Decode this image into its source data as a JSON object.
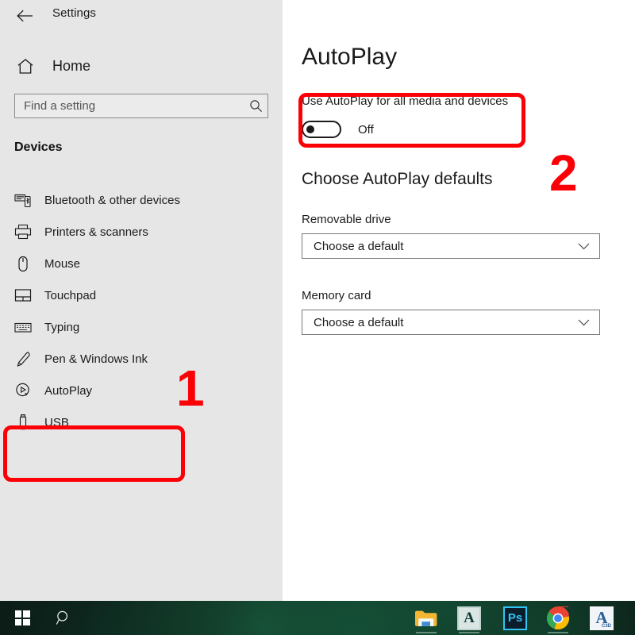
{
  "window": {
    "title": "Settings",
    "back_icon": "back-arrow-icon"
  },
  "sidebar": {
    "home": {
      "label": "Home",
      "icon": "home-icon"
    },
    "search": {
      "value": "",
      "placeholder": "Find a setting",
      "icon": "search-icon"
    },
    "section_header": "Devices",
    "items": [
      {
        "label": "Bluetooth & other devices",
        "icon": "bluetooth-devices-icon"
      },
      {
        "label": "Printers & scanners",
        "icon": "printer-icon"
      },
      {
        "label": "Mouse",
        "icon": "mouse-icon"
      },
      {
        "label": "Touchpad",
        "icon": "touchpad-icon"
      },
      {
        "label": "Typing",
        "icon": "keyboard-icon"
      },
      {
        "label": "Pen & Windows Ink",
        "icon": "pen-icon"
      },
      {
        "label": "AutoPlay",
        "icon": "autoplay-icon"
      },
      {
        "label": "USB",
        "icon": "usb-icon"
      }
    ]
  },
  "main": {
    "page_title": "AutoPlay",
    "toggle": {
      "label": "Use AutoPlay for all media and devices",
      "state": "Off",
      "on": false
    },
    "subsection_title": "Choose AutoPlay defaults",
    "fields": [
      {
        "label": "Removable drive",
        "value": "Choose a default",
        "icon": "chevron-down-icon"
      },
      {
        "label": "Memory card",
        "value": "Choose a default",
        "icon": "chevron-down-icon"
      }
    ]
  },
  "annotations": {
    "color": "#fb0007",
    "step_one": "1",
    "step_two": "2"
  },
  "taskbar": {
    "start": {
      "icon": "windows-logo-icon"
    },
    "search": {
      "icon": "search-icon"
    },
    "apps": [
      {
        "name": "File Explorer",
        "icon": "folder-icon"
      },
      {
        "name": "Font Viewer",
        "icon": "font-app-icon",
        "glyph": "A"
      },
      {
        "name": "Adobe Photoshop",
        "icon": "photoshop-icon",
        "glyph": "Ps"
      },
      {
        "name": "Google Chrome",
        "icon": "chrome-icon"
      },
      {
        "name": "AutoCAD",
        "icon": "autocad-icon",
        "glyph": "A",
        "sub": "C3D"
      }
    ]
  }
}
